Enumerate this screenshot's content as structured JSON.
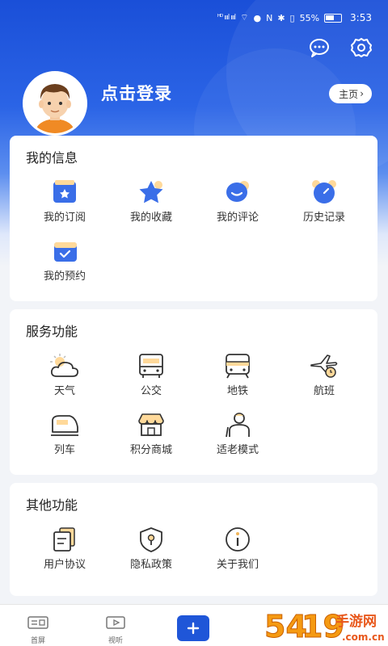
{
  "status_bar": {
    "signal_text": "ıııl ıııl",
    "battery": "55%",
    "time": "3:53"
  },
  "profile": {
    "login_text": "点击登录",
    "home_label": "主页"
  },
  "my_info": {
    "title": "我的信息",
    "items": [
      {
        "label": "我的订阅",
        "icon": "subscription-icon"
      },
      {
        "label": "我的收藏",
        "icon": "star-icon"
      },
      {
        "label": "我的评论",
        "icon": "comment-icon"
      },
      {
        "label": "历史记录",
        "icon": "clock-icon"
      },
      {
        "label": "我的预约",
        "icon": "calendar-check-icon"
      }
    ]
  },
  "services": {
    "title": "服务功能",
    "items": [
      {
        "label": "天气",
        "icon": "weather-icon"
      },
      {
        "label": "公交",
        "icon": "bus-icon"
      },
      {
        "label": "地铁",
        "icon": "subway-icon"
      },
      {
        "label": "航班",
        "icon": "flight-icon"
      },
      {
        "label": "列车",
        "icon": "train-icon"
      },
      {
        "label": "积分商城",
        "icon": "shop-icon"
      },
      {
        "label": "适老模式",
        "icon": "elderly-icon"
      }
    ]
  },
  "other": {
    "title": "其他功能",
    "items": [
      {
        "label": "用户协议",
        "icon": "document-icon"
      },
      {
        "label": "隐私政策",
        "icon": "shield-lock-icon"
      },
      {
        "label": "关于我们",
        "icon": "info-icon"
      }
    ]
  },
  "bottom_nav": {
    "items": [
      {
        "label": "首屏",
        "icon": "home-screen-icon"
      },
      {
        "label": "视听",
        "icon": "video-icon"
      }
    ]
  },
  "watermark": {
    "text": "5419手游网",
    "sub": ".com.cn"
  },
  "colors": {
    "brand": "#1f56d8",
    "accent_light": "#ffd99a"
  }
}
